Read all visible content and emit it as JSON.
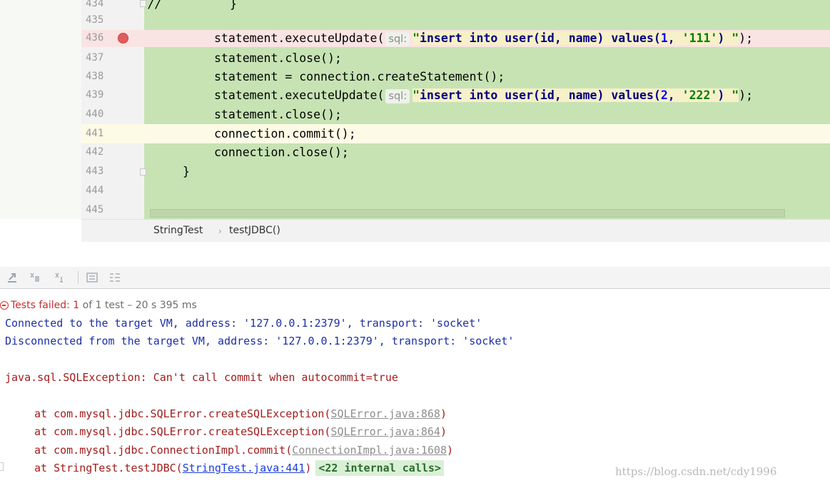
{
  "editor": {
    "lines": [
      {
        "num": "434",
        "text": ""
      },
      {
        "num": "435",
        "text": ""
      },
      {
        "num": "436",
        "text": ""
      },
      {
        "num": "437",
        "text": "statement.close();"
      },
      {
        "num": "438",
        "text": "statement = connection.createStatement();"
      },
      {
        "num": "439",
        "text": ""
      },
      {
        "num": "440",
        "text": "statement.close();"
      },
      {
        "num": "441",
        "text": "connection.commit();"
      },
      {
        "num": "442",
        "text": "connection.close();"
      },
      {
        "num": "443",
        "text": "}"
      },
      {
        "num": "444",
        "text": ""
      },
      {
        "num": "445",
        "text": ""
      }
    ],
    "line434_comment": "//",
    "line434_brace": "}",
    "exec1": {
      "method": "statement.executeUpdate(",
      "hint": "sql:",
      "sql_open": "\"",
      "kw_insert": "insert",
      "kw_into": "into",
      "table": "user(id,",
      "kw_name": "name)",
      "kw_values": "values(",
      "num": "1",
      "comma": ",",
      "val": "'111'",
      "close_paren": ")",
      "sql_close": "\"",
      "end": ");"
    },
    "exec2": {
      "method": "statement.executeUpdate(",
      "hint": "sql:",
      "sql_open": "\"",
      "kw_insert": "insert",
      "kw_into": "into",
      "table": "user(id,",
      "kw_name": "name)",
      "kw_values": "values(",
      "num": "2",
      "comma": ",",
      "val": "'222'",
      "close_paren": ")",
      "sql_close": "\"",
      "end": ");"
    }
  },
  "breadcrumb": {
    "class_name": "StringTest",
    "separator": "›",
    "method_name": "testJDBC()"
  },
  "toolbar": {
    "icons": [
      "export-icon",
      "sort-alpha-icon",
      "sort-duration-icon",
      "expand-icon",
      "collapse-icon"
    ]
  },
  "status": {
    "prefix": "Tests failed: 1",
    "suffix": " of 1 test – 20 s 395 ms"
  },
  "console": {
    "connected": "Connected to the target VM, address: '127.0.0.1:2379', transport: 'socket'",
    "disconnected": "Disconnected from the target VM, address: '127.0.0.1:2379', transport: 'socket'",
    "exception": "java.sql.SQLException: Can't call commit when autocommit=true",
    "trace": [
      {
        "prefix": "at com.mysql.jdbc.SQLError.createSQLException(",
        "link": "SQLError.java:868",
        "suffix": ")"
      },
      {
        "prefix": "at com.mysql.jdbc.SQLError.createSQLException(",
        "link": "SQLError.java:864",
        "suffix": ")"
      },
      {
        "prefix": "at com.mysql.jdbc.ConnectionImpl.commit(",
        "link": "ConnectionImpl.java:1608",
        "suffix": ")"
      },
      {
        "prefix": "at StringTest.testJDBC(",
        "link": "StringTest.java:441",
        "suffix": ")",
        "internal": "<22 internal calls>"
      }
    ]
  },
  "watermark": "https://blog.csdn.net/cdy1996",
  "colors": {
    "code_bg": "#c7e3b4",
    "breakpoint_line": "#fae3e3",
    "current_line": "#fdfae6",
    "breakpoint_dot": "#e05c5c",
    "error_red": "#a21c1c",
    "console_blue": "#1c2fa6"
  }
}
